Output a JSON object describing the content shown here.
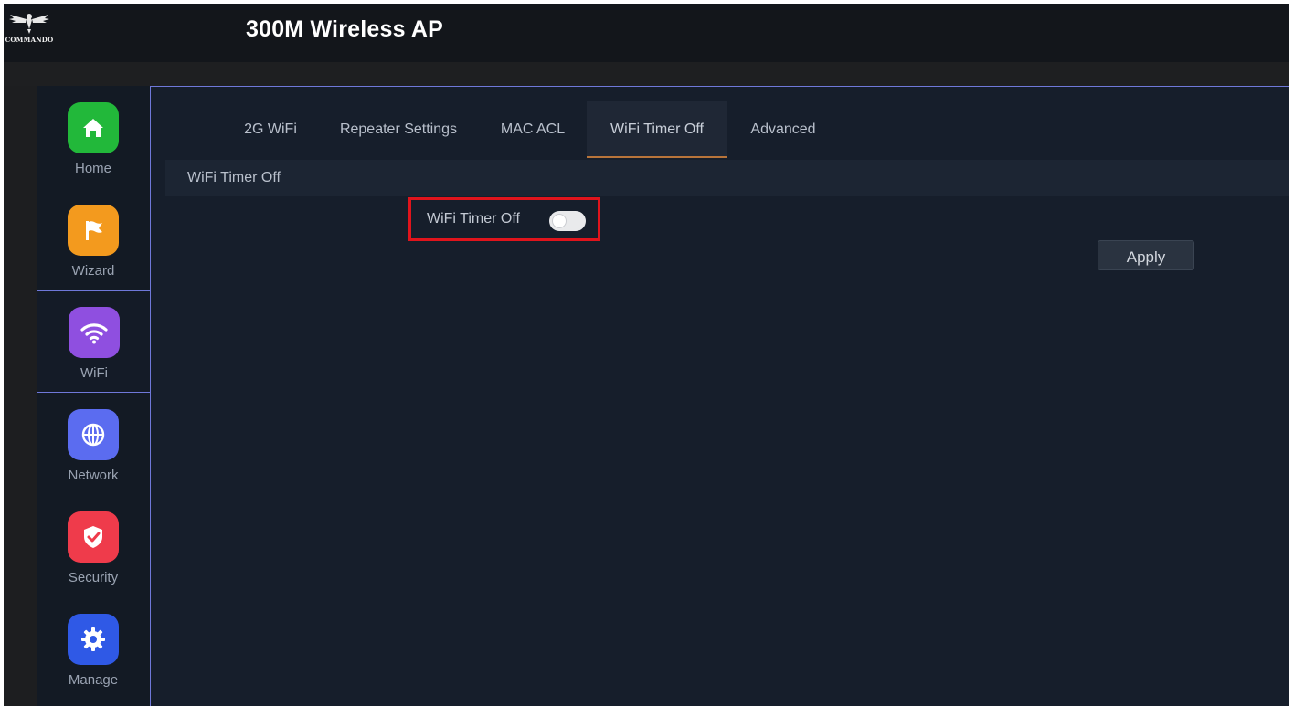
{
  "header": {
    "title": "300M Wireless AP",
    "logo_text": "COMMANDO"
  },
  "sidebar": {
    "items": [
      {
        "label": "Home",
        "icon": "home-icon",
        "color": "#22b83a"
      },
      {
        "label": "Wizard",
        "icon": "flag-icon",
        "color": "#f39a1e"
      },
      {
        "label": "WiFi",
        "icon": "wifi-icon",
        "color": "#8f4fe0",
        "active": true
      },
      {
        "label": "Network",
        "icon": "globe-icon",
        "color": "#5b6cf0"
      },
      {
        "label": "Security",
        "icon": "shield-icon",
        "color": "#ef3b4b"
      },
      {
        "label": "Manage",
        "icon": "gear-icon",
        "color": "#2f59e6"
      }
    ]
  },
  "tabs": [
    {
      "label": "2G WiFi"
    },
    {
      "label": "Repeater Settings"
    },
    {
      "label": "MAC ACL"
    },
    {
      "label": "WiFi Timer Off",
      "active": true
    },
    {
      "label": "Advanced"
    }
  ],
  "section": {
    "title": "WiFi Timer Off"
  },
  "form": {
    "timer_label": "WiFi Timer Off",
    "timer_enabled": false,
    "apply_label": "Apply"
  },
  "colors": {
    "accent_border": "#6f78d9",
    "highlight_box": "#e0141c",
    "active_tab_underline": "#b8743a"
  }
}
